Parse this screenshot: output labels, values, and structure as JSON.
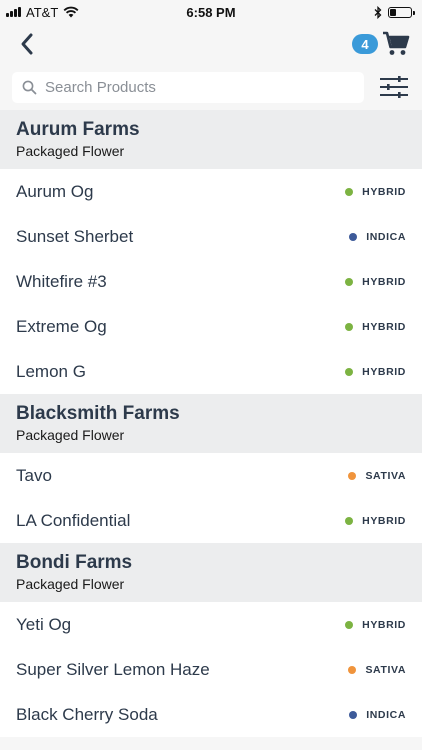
{
  "status_bar": {
    "carrier": "AT&T",
    "time": "6:58 PM"
  },
  "nav": {
    "cart_count": "4"
  },
  "search": {
    "placeholder": "Search Products"
  },
  "type_colors": {
    "HYBRID": "#7cb342",
    "INDICA": "#3d5a99",
    "SATIVA": "#f0943c"
  },
  "sections": [
    {
      "title": "Aurum Farms",
      "subtitle": "Packaged Flower",
      "items": [
        {
          "name": "Aurum Og",
          "type": "HYBRID"
        },
        {
          "name": "Sunset Sherbet",
          "type": "INDICA"
        },
        {
          "name": "Whitefire #3",
          "type": "HYBRID"
        },
        {
          "name": "Extreme Og",
          "type": "HYBRID"
        },
        {
          "name": "Lemon G",
          "type": "HYBRID"
        }
      ]
    },
    {
      "title": "Blacksmith Farms",
      "subtitle": "Packaged Flower",
      "items": [
        {
          "name": "Tavo",
          "type": "SATIVA"
        },
        {
          "name": "LA Confidential",
          "type": "HYBRID"
        }
      ]
    },
    {
      "title": "Bondi Farms",
      "subtitle": "Packaged Flower",
      "items": [
        {
          "name": "Yeti Og",
          "type": "HYBRID"
        },
        {
          "name": "Super Silver Lemon Haze",
          "type": "SATIVA"
        },
        {
          "name": "Black Cherry Soda",
          "type": "INDICA"
        }
      ]
    }
  ]
}
